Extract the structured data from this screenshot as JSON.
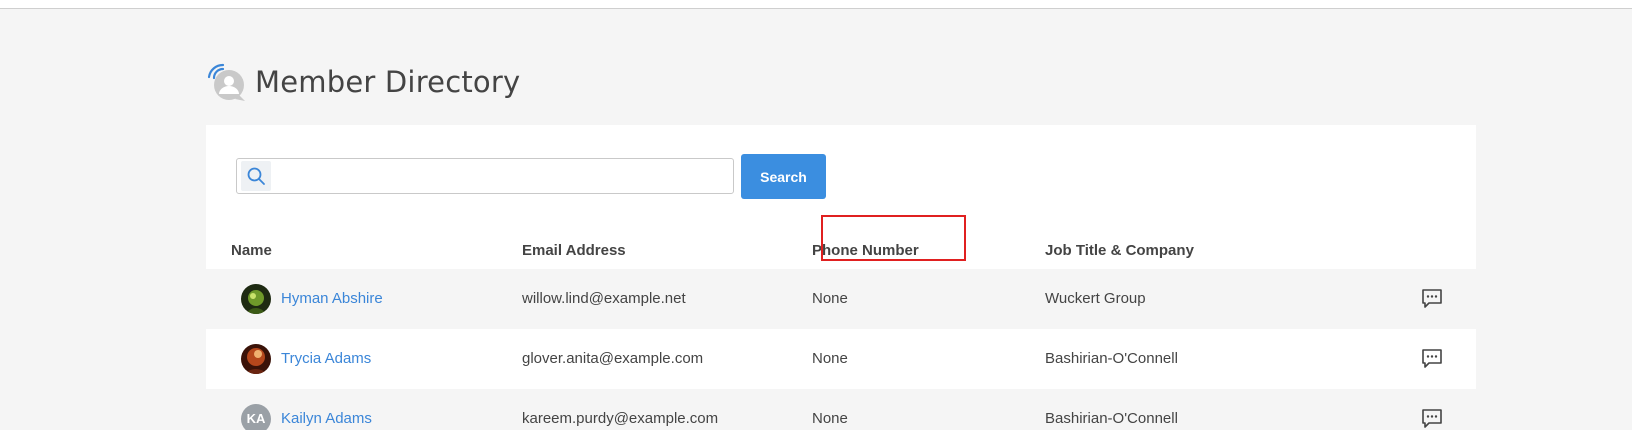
{
  "page": {
    "title": "Member Directory",
    "icon": "member-directory-icon"
  },
  "search": {
    "placeholder": "",
    "value": "",
    "button_label": "Search",
    "icon": "search-icon"
  },
  "table": {
    "columns": [
      "Name",
      "Email Address",
      "Phone Number",
      "Job Title & Company"
    ],
    "rows": [
      {
        "name": "Hyman Abshire",
        "email": "willow.lind@example.net",
        "phone": "None",
        "company": "Wuckert Group",
        "avatar": "photo"
      },
      {
        "name": "Trycia Adams",
        "email": "glover.anita@example.com",
        "phone": "None",
        "company": "Bashirian-O'Connell",
        "avatar": "photo"
      },
      {
        "name": "Kailyn Adams",
        "email": "kareem.purdy@example.com",
        "phone": "None",
        "company": "Bashirian-O'Connell",
        "avatar": "initials",
        "initials": "KA"
      }
    ]
  },
  "colors": {
    "accent": "#3b8ee0",
    "link": "#3b86d8",
    "highlight": "#e02020"
  }
}
